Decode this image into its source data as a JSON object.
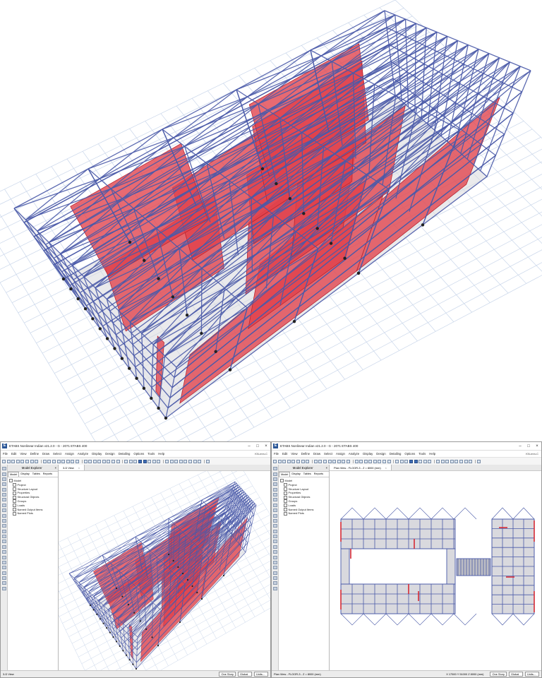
{
  "left_window": {
    "title": "ETABS Nonlinear Indian v21.2.0 - G - 2071 ETABS 400",
    "menu": [
      "File",
      "Edit",
      "View",
      "Define",
      "Draw",
      "Select",
      "Assign",
      "Analyze",
      "Display",
      "Design",
      "Detailing",
      "Options",
      "Tools",
      "Help"
    ],
    "units": "KN-mm-C",
    "explorer_title": "Model Explorer",
    "explorer_tabs": [
      "Model",
      "Display",
      "Tables",
      "Reports"
    ],
    "tree_root": "Model",
    "tree_items": [
      "Project",
      "Structure Layout",
      "Properties",
      "Structural Objects",
      "Groups",
      "Loads",
      "Named Output Items",
      "Named Plots"
    ],
    "view_tab": "3-D View",
    "status_left": "3-D View",
    "story_mode": "One Story",
    "coord_system": "Global",
    "units_button": "Units..."
  },
  "right_window": {
    "title": "ETABS Nonlinear Indian v21.2.0 - G - 2071 ETABS 400",
    "menu": [
      "File",
      "Edit",
      "View",
      "Define",
      "Draw",
      "Select",
      "Assign",
      "Analyze",
      "Display",
      "Design",
      "Detailing",
      "Options",
      "Tools",
      "Help"
    ],
    "units": "KN-mm-C",
    "explorer_title": "Model Explorer",
    "explorer_tabs": [
      "Model",
      "Display",
      "Tables",
      "Reports"
    ],
    "tree_root": "Model",
    "tree_items": [
      "Project",
      "Structure Layout",
      "Properties",
      "Structural Objects",
      "Groups",
      "Loads",
      "Named Output Items",
      "Named Plots"
    ],
    "view_tab": "Plan View - FLOOR-3 - Z = 8000 (mm)",
    "status_left": "Plan View - FLOOR-3 - Z = 8000 (mm)",
    "coords": "X 17500  Y 51000  Z 8000 (mm)",
    "story_mode": "One Story",
    "coord_system": "Global",
    "units_button": "Units..."
  },
  "colors": {
    "frame": "#4a5aa8",
    "wall": "#e0404a",
    "grid": "#c9d6ea",
    "slab": "#d8d8dc"
  }
}
